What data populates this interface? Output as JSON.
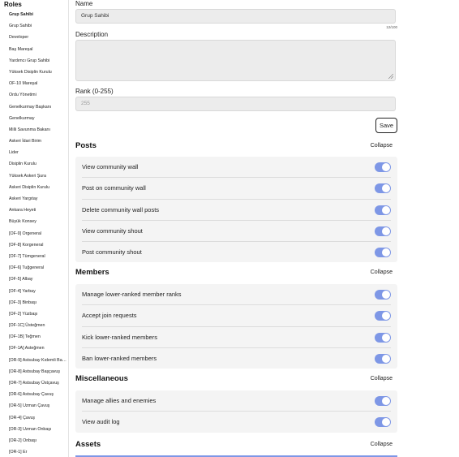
{
  "sidebar": {
    "title": "Roles",
    "roles": [
      "Grup Sahibi",
      "Grup Sahibi",
      "Developer",
      "Baş Mareşal",
      "Yardımcı Grup Sahibi",
      "Yüksek Disiplin Kurulu",
      "OF-10 Mareşal",
      "Ordu Yönetimi",
      "Genelkurmay Başkanı",
      "Genelkurmay",
      "Milli Savunma Bakanı",
      "Askeri İdari Birim",
      "Lider",
      "Disiplin Kurulu",
      "Yüksek Askeri Şura",
      "Askeri Disiplin Kurulu",
      "Askeri Yargıtay",
      "Ankara Heyeti",
      "Büyük Konsey",
      "[OF-9] Orgeneral",
      "[OF-8] Korgeneral",
      "[OF-7] Tümgeneral",
      "[OF-6] Tuğgeneral",
      "[OF-5] Albay",
      "[OF-4] Yarbay",
      "[OF-3] Binbaşı",
      "[OF-2] Yüzbaşı",
      "[OF-1C] Üsteğmen",
      "[OF-1B] Teğmen",
      "[OF-1A] Asteğmen",
      "[OR-9] Astsubay Kıdemli Başçavuş",
      "[OR-8] Astsubay Başçavuş",
      "[OR-7] Astsubay Üstçavuş",
      "[OR-6] Astsubay Çavuş",
      "[OR-5] Uzman Çavuş",
      "[OR-4] Çavuş",
      "[OR-3] Uzman Onbaşı",
      "[OR-2] Onbaşı",
      "[OR-1] Er"
    ]
  },
  "form": {
    "name_label": "Name",
    "name_value": "Grup Sahibi",
    "name_counter": "12/100",
    "description_label": "Description",
    "description_value": "",
    "rank_label": "Rank (0-255)",
    "rank_value": "255",
    "save_label": "Save"
  },
  "sections": [
    {
      "title": "Posts",
      "collapse_label": "Collapse",
      "permissions": [
        {
          "label": "View community wall",
          "enabled": true
        },
        {
          "label": "Post on community wall",
          "enabled": true
        },
        {
          "label": "Delete community wall posts",
          "enabled": true
        },
        {
          "label": "View community shout",
          "enabled": true
        },
        {
          "label": "Post community shout",
          "enabled": true
        }
      ]
    },
    {
      "title": "Members",
      "collapse_label": "Collapse",
      "permissions": [
        {
          "label": "Manage lower-ranked member ranks",
          "enabled": true
        },
        {
          "label": "Accept join requests",
          "enabled": true
        },
        {
          "label": "Kick lower-ranked members",
          "enabled": true
        },
        {
          "label": "Ban lower-ranked members",
          "enabled": true
        }
      ]
    },
    {
      "title": "Miscellaneous",
      "collapse_label": "Collapse",
      "permissions": [
        {
          "label": "Manage allies and enemies",
          "enabled": true
        },
        {
          "label": "View audit log",
          "enabled": true
        }
      ]
    },
    {
      "title": "Assets",
      "collapse_label": "Collapse",
      "permissions": []
    }
  ],
  "colors": {
    "toggle_on": "#7e97e6",
    "panel_bg": "#f4f4f4",
    "input_bg": "#ececec"
  }
}
